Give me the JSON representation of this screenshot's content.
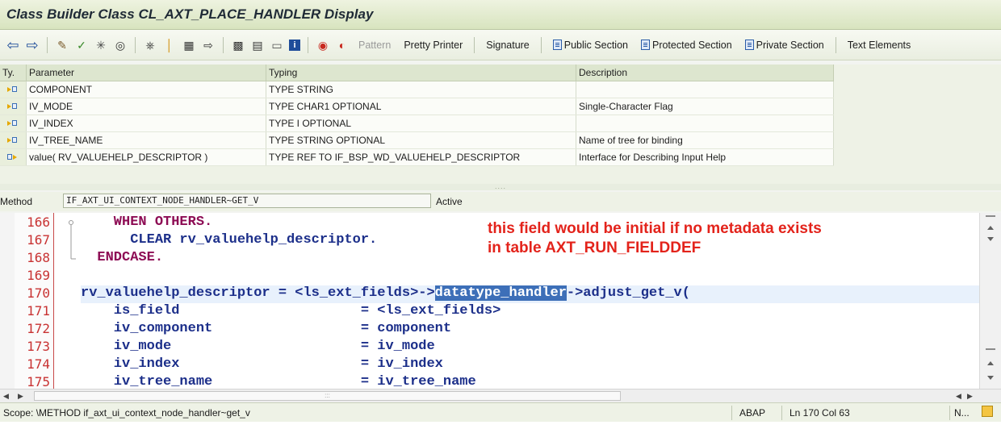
{
  "window": {
    "title": "Class Builder Class CL_AXT_PLACE_HANDLER Display"
  },
  "toolbar": {
    "icons": [
      "back-arrow-icon",
      "forward-arrow-icon",
      "other-object-icon",
      "check-icon",
      "activate-icon",
      "test-icon",
      "where-used-icon",
      "navigation-icon",
      "outline-icon",
      "display-object-list-icon",
      "hierarchy-icon",
      "window-icon",
      "info-icon",
      "breakpoint-icon",
      "session-breakpoint-icon"
    ],
    "pattern": "Pattern",
    "pretty_printer": "Pretty Printer",
    "signature": "Signature",
    "public_section": "Public Section",
    "protected_section": "Protected Section",
    "private_section": "Private Section",
    "text_elements": "Text Elements"
  },
  "params": {
    "headers": {
      "ty": "Ty.",
      "parameter": "Parameter",
      "typing": "Typing",
      "description": "Description"
    },
    "rows": [
      {
        "kind": "importing",
        "name": "COMPONENT",
        "typing": "TYPE STRING",
        "description": ""
      },
      {
        "kind": "importing",
        "name": "IV_MODE",
        "typing": "TYPE CHAR1 OPTIONAL",
        "description": "Single-Character Flag"
      },
      {
        "kind": "importing",
        "name": "IV_INDEX",
        "typing": "TYPE I OPTIONAL",
        "description": ""
      },
      {
        "kind": "importing",
        "name": "IV_TREE_NAME",
        "typing": "TYPE STRING OPTIONAL",
        "description": "Name of tree for binding"
      },
      {
        "kind": "returning",
        "name": "value( RV_VALUEHELP_DESCRIPTOR )",
        "typing": "TYPE REF TO IF_BSP_WD_VALUEHELP_DESCRIPTOR",
        "description": "Interface for Describing Input Help"
      }
    ]
  },
  "method": {
    "label": "Method",
    "name": "IF_AXT_UI_CONTEXT_NODE_HANDLER~GET_V",
    "status": "Active"
  },
  "editor": {
    "lines": [
      {
        "num": "166",
        "code": "    WHEN OTHERS."
      },
      {
        "num": "167",
        "code": "      CLEAR rv_valuehelp_descriptor."
      },
      {
        "num": "168",
        "code": "  ENDCASE."
      },
      {
        "num": "169",
        "code": ""
      },
      {
        "num": "170",
        "code": "rv_valuehelp_descriptor = <ls_ext_fields>->datatype_handler->adjust_get_v("
      },
      {
        "num": "171",
        "code": "    is_field                      = <ls_ext_fields>"
      },
      {
        "num": "172",
        "code": "    iv_component                  = component"
      },
      {
        "num": "173",
        "code": "    iv_mode                       = iv_mode"
      },
      {
        "num": "174",
        "code": "    iv_index                      = iv_index"
      },
      {
        "num": "175",
        "code": "    iv_tree_name                  = iv_tree_name"
      }
    ],
    "annotation": [
      "this field would be initial if no metadata exists",
      "in table AXT_RUN_FIELDDEF"
    ]
  },
  "status": {
    "scope": "Scope: \\METHOD if_axt_ui_context_node_handler~get_v",
    "language": "ABAP",
    "position": "Ln 170 Col 63",
    "mode": "N..."
  }
}
